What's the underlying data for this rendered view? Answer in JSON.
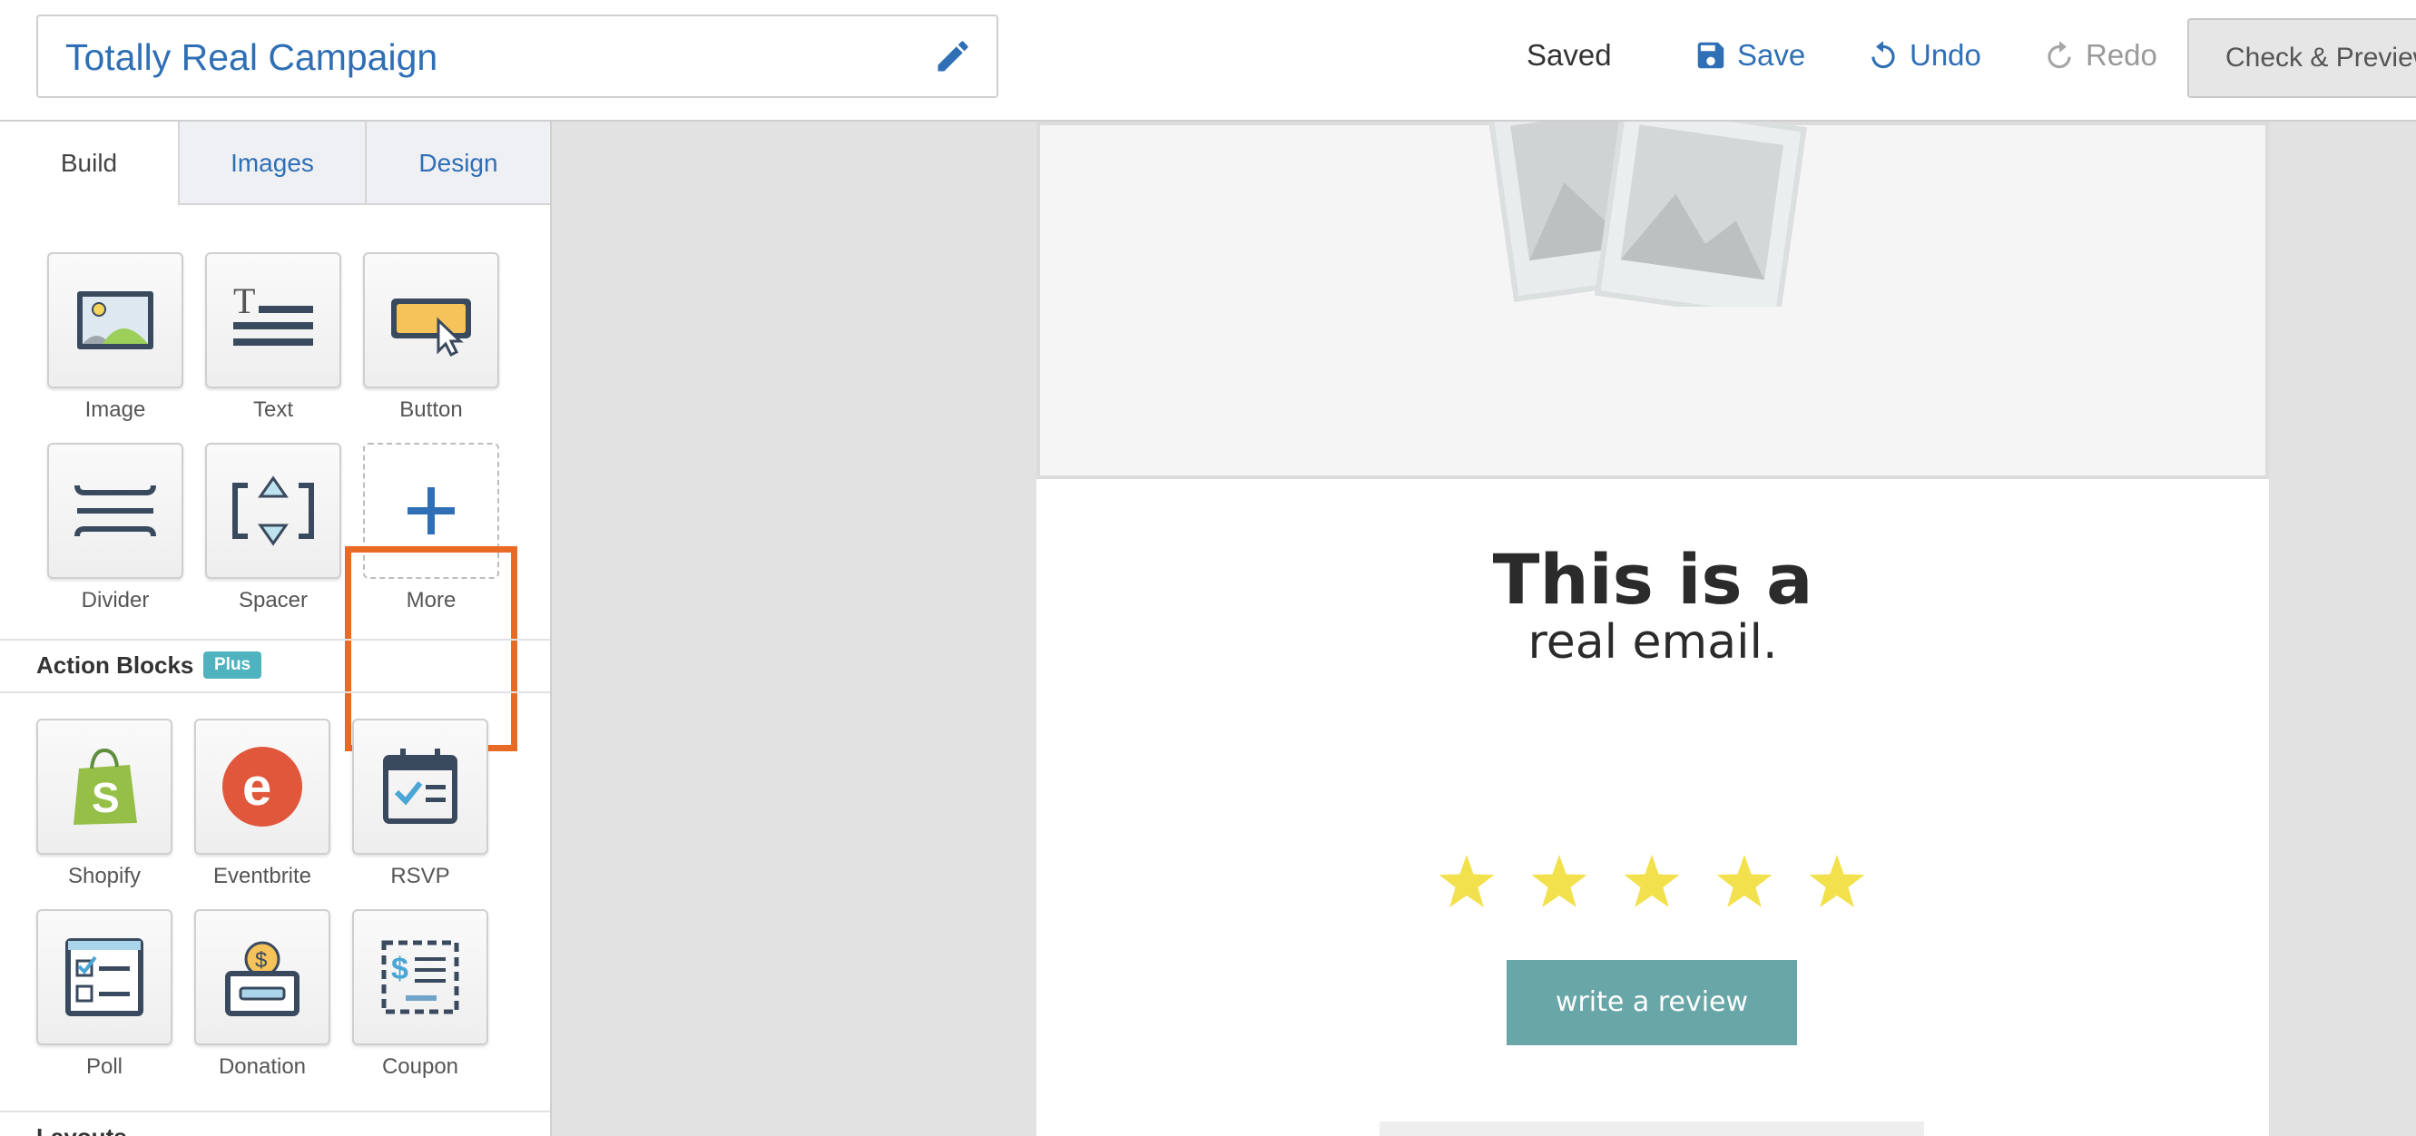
{
  "campaign": {
    "title": "Totally Real Campaign"
  },
  "toolbar": {
    "status": "Saved",
    "save_label": "Save",
    "undo_label": "Undo",
    "redo_label": "Redo",
    "check_label": "Check & Preview",
    "accent_color": "#2f6fb5"
  },
  "sidebar": {
    "tabs": [
      {
        "label": "Build",
        "active": true
      },
      {
        "label": "Images",
        "active": false
      },
      {
        "label": "Design",
        "active": false
      }
    ],
    "build_blocks": [
      {
        "label": "Image",
        "icon": "image-icon"
      },
      {
        "label": "Text",
        "icon": "text-icon"
      },
      {
        "label": "Button",
        "icon": "button-icon"
      },
      {
        "label": "Divider",
        "icon": "divider-icon"
      },
      {
        "label": "Spacer",
        "icon": "spacer-icon"
      },
      {
        "label": "More",
        "icon": "plus-icon",
        "highlighted": true
      }
    ],
    "action_blocks": {
      "title": "Action Blocks",
      "badge": "Plus",
      "items": [
        {
          "label": "Shopify",
          "icon": "shopify-icon"
        },
        {
          "label": "Eventbrite",
          "icon": "eventbrite-icon"
        },
        {
          "label": "RSVP",
          "icon": "calendar-icon"
        },
        {
          "label": "Poll",
          "icon": "poll-icon"
        },
        {
          "label": "Donation",
          "icon": "donation-icon"
        },
        {
          "label": "Coupon",
          "icon": "coupon-icon"
        }
      ]
    },
    "layout_title": "Layouts",
    "highlight_color": "#e96a25"
  },
  "email": {
    "headline": "This is a",
    "subline": "real email.",
    "rating": {
      "value": 5,
      "max": 5
    },
    "cta_label": "write a review",
    "cta_color": "#69a6a8",
    "star_color": "#f2e14c"
  }
}
